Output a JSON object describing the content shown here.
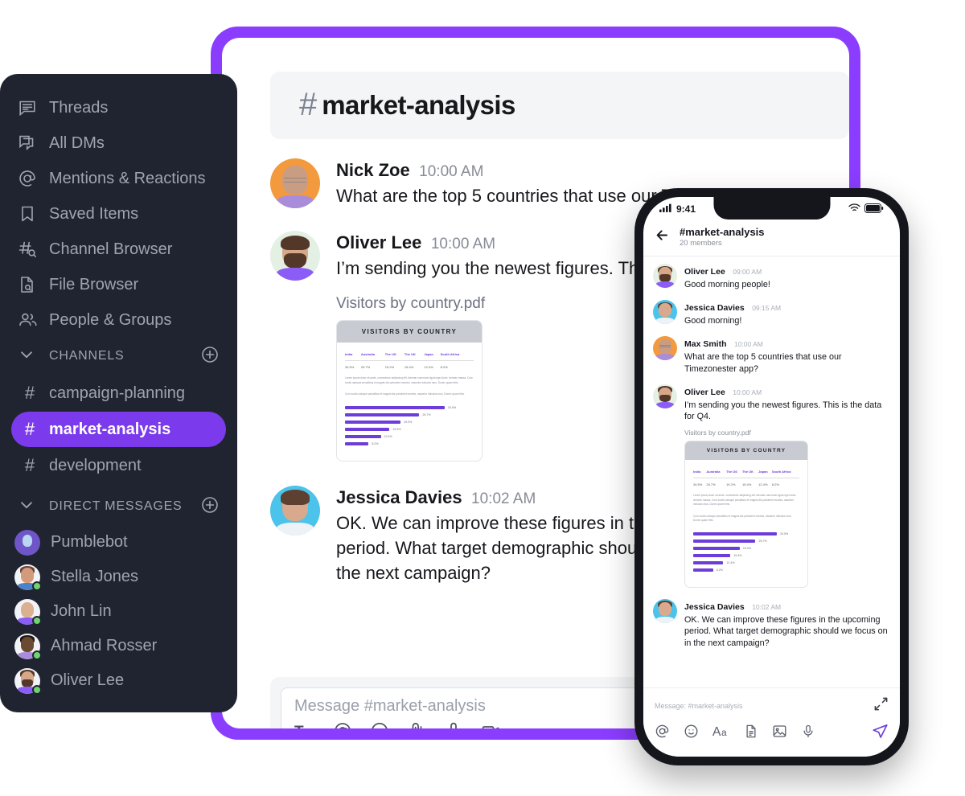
{
  "sidebar": {
    "nav_items": [
      {
        "label": "Threads",
        "icon": "threads-icon"
      },
      {
        "label": "All DMs",
        "icon": "all-dms-icon"
      },
      {
        "label": "Mentions & Reactions",
        "icon": "mentions-icon"
      },
      {
        "label": "Saved Items",
        "icon": "bookmark-icon"
      },
      {
        "label": "Channel Browser",
        "icon": "channel-browser-icon"
      },
      {
        "label": "File Browser",
        "icon": "file-browser-icon"
      },
      {
        "label": "People & Groups",
        "icon": "people-groups-icon"
      }
    ],
    "channels_section": {
      "title": "CHANNELS",
      "add_label": "+"
    },
    "channels": [
      {
        "name": "campaign-planning",
        "active": false
      },
      {
        "name": "market-analysis",
        "active": true
      },
      {
        "name": "development",
        "active": false
      }
    ],
    "dm_section": {
      "title": "DIRECT MESSAGES",
      "add_label": "+"
    },
    "dms": [
      {
        "name": "Pumblebot",
        "online": false
      },
      {
        "name": "Stella Jones",
        "online": true
      },
      {
        "name": "John Lin",
        "online": true
      },
      {
        "name": "Ahmad Rosser",
        "online": true
      },
      {
        "name": "Oliver Lee",
        "online": true
      }
    ]
  },
  "desktop": {
    "header": {
      "hash": "#",
      "channel": "market-analysis"
    },
    "messages": [
      {
        "author": "Nick Zoe",
        "time": "10:00 AM",
        "text": "What are the top 5 countries that use our Timezonester app?"
      },
      {
        "author": "Oliver Lee",
        "time": "10:00 AM",
        "text": " I’m sending you the newest figures. This is the data for Q4.",
        "attachment_name": "Visitors by country.pdf"
      },
      {
        "author": "Jessica Davies",
        "time": "10:02 AM",
        "text": "OK. We can improve these figures in the upcoming period. What target demographic should we focus on in the next campaign?"
      }
    ],
    "composer": {
      "placeholder": "Message #market-analysis",
      "tools": [
        "text-format-icon",
        "mention-icon",
        "emoji-icon",
        "attachment-icon",
        "microphone-icon",
        "video-icon"
      ]
    }
  },
  "phone": {
    "status_bar": {
      "time": "9:41",
      "signal": "signal-icon",
      "wifi": "wifi-icon",
      "battery": "battery-icon"
    },
    "header": {
      "back": "back-arrow-icon",
      "title": "#market-analysis",
      "subtitle": "20 members"
    },
    "messages": [
      {
        "author": "Oliver Lee",
        "time": "09:00 AM",
        "text": "Good morning people!"
      },
      {
        "author": "Jessica Davies",
        "time": "09:15 AM",
        "text": "Good morning!"
      },
      {
        "author": "Max Smith",
        "time": "10:00 AM",
        "text": "What are the top 5 countries that use our Timezonester app?"
      },
      {
        "author": "Oliver Lee",
        "time": "10:00 AM",
        "text": " I’m sending you the newest figures. This is the data for Q4.",
        "attachment_name": "Visitors by country.pdf"
      },
      {
        "author": "Jessica Davies",
        "time": "10:02 AM",
        "text": "OK. We can improve these figures in the upcoming period. What target demographic should we focus on in the next campaign?"
      }
    ],
    "composer": {
      "placeholder": "Message: #market-analysis",
      "expand": "expand-icon",
      "icons": [
        "mention-icon",
        "emoji-icon",
        "text-format-icon",
        "document-icon",
        "image-icon",
        "microphone-icon"
      ],
      "send": "send-icon"
    }
  },
  "pdf_preview": {
    "title": "VISITORS BY COUNTRY",
    "paragraph1": "Lorem ipsum dolor sit amet, consectetur adipiscing elit. Aenean commodo ligula eget dolor. Aenean massa. Cum sociis natoque penatibus et magnis dis parturient montes, nascetur ridiculus mus. Donec quam felis.",
    "paragraph2": "Cum sociis natoque penatibus et magnis dis parturient montes, nascetur ridiculus mus. Donec quam felis."
  },
  "chart_data": {
    "type": "bar",
    "title": "VISITORS BY COUNTRY",
    "categories": [
      "India",
      "Australia",
      "The US",
      "The UK",
      "Japan",
      "South Africa"
    ],
    "values": [
      34.5,
      25.7,
      19.2,
      15.4,
      12.4,
      8.2
    ],
    "value_labels": [
      "34.5%",
      "25.7%",
      "19.2%",
      "15.4%",
      "12.4%",
      "8.2%"
    ],
    "xlabel": "",
    "ylabel": "",
    "ylim": [
      0,
      40
    ],
    "grid": false,
    "legend": "none",
    "bar_color": "#6d3ddb"
  },
  "colors": {
    "frame_purple": "#8b3dff",
    "active_channel": "#7c3aed",
    "sidebar_bg": "#1f2430",
    "accent": "#6d3ddb",
    "online": "#6fd36f"
  }
}
